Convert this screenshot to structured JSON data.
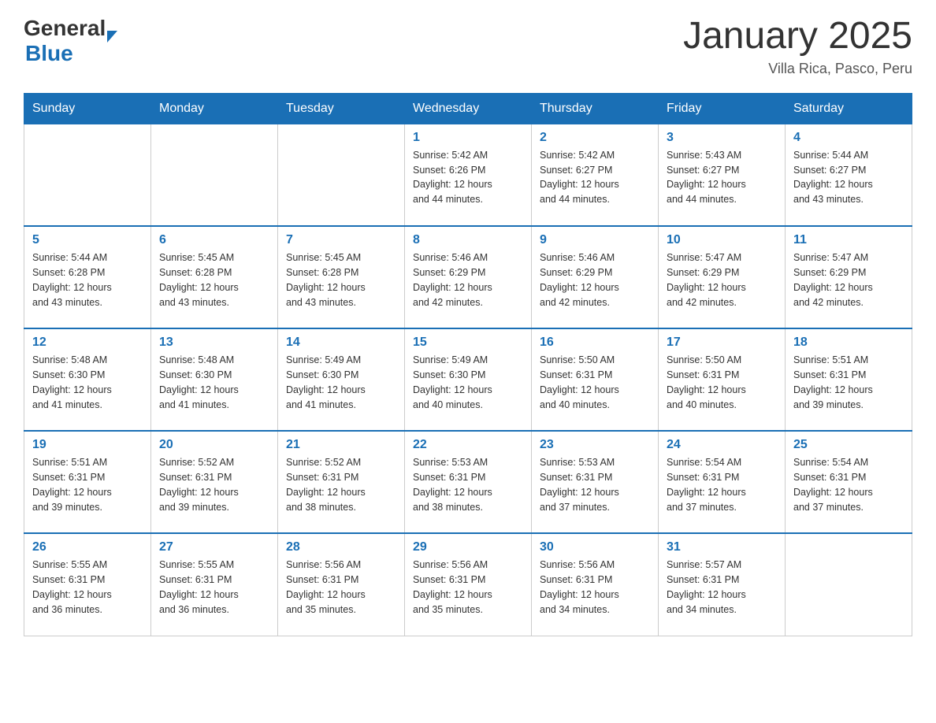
{
  "header": {
    "logo_general": "General",
    "logo_blue": "Blue",
    "title": "January 2025",
    "subtitle": "Villa Rica, Pasco, Peru"
  },
  "days_of_week": [
    "Sunday",
    "Monday",
    "Tuesday",
    "Wednesday",
    "Thursday",
    "Friday",
    "Saturday"
  ],
  "weeks": [
    [
      {
        "day": "",
        "info": ""
      },
      {
        "day": "",
        "info": ""
      },
      {
        "day": "",
        "info": ""
      },
      {
        "day": "1",
        "info": "Sunrise: 5:42 AM\nSunset: 6:26 PM\nDaylight: 12 hours\nand 44 minutes."
      },
      {
        "day": "2",
        "info": "Sunrise: 5:42 AM\nSunset: 6:27 PM\nDaylight: 12 hours\nand 44 minutes."
      },
      {
        "day": "3",
        "info": "Sunrise: 5:43 AM\nSunset: 6:27 PM\nDaylight: 12 hours\nand 44 minutes."
      },
      {
        "day": "4",
        "info": "Sunrise: 5:44 AM\nSunset: 6:27 PM\nDaylight: 12 hours\nand 43 minutes."
      }
    ],
    [
      {
        "day": "5",
        "info": "Sunrise: 5:44 AM\nSunset: 6:28 PM\nDaylight: 12 hours\nand 43 minutes."
      },
      {
        "day": "6",
        "info": "Sunrise: 5:45 AM\nSunset: 6:28 PM\nDaylight: 12 hours\nand 43 minutes."
      },
      {
        "day": "7",
        "info": "Sunrise: 5:45 AM\nSunset: 6:28 PM\nDaylight: 12 hours\nand 43 minutes."
      },
      {
        "day": "8",
        "info": "Sunrise: 5:46 AM\nSunset: 6:29 PM\nDaylight: 12 hours\nand 42 minutes."
      },
      {
        "day": "9",
        "info": "Sunrise: 5:46 AM\nSunset: 6:29 PM\nDaylight: 12 hours\nand 42 minutes."
      },
      {
        "day": "10",
        "info": "Sunrise: 5:47 AM\nSunset: 6:29 PM\nDaylight: 12 hours\nand 42 minutes."
      },
      {
        "day": "11",
        "info": "Sunrise: 5:47 AM\nSunset: 6:29 PM\nDaylight: 12 hours\nand 42 minutes."
      }
    ],
    [
      {
        "day": "12",
        "info": "Sunrise: 5:48 AM\nSunset: 6:30 PM\nDaylight: 12 hours\nand 41 minutes."
      },
      {
        "day": "13",
        "info": "Sunrise: 5:48 AM\nSunset: 6:30 PM\nDaylight: 12 hours\nand 41 minutes."
      },
      {
        "day": "14",
        "info": "Sunrise: 5:49 AM\nSunset: 6:30 PM\nDaylight: 12 hours\nand 41 minutes."
      },
      {
        "day": "15",
        "info": "Sunrise: 5:49 AM\nSunset: 6:30 PM\nDaylight: 12 hours\nand 40 minutes."
      },
      {
        "day": "16",
        "info": "Sunrise: 5:50 AM\nSunset: 6:31 PM\nDaylight: 12 hours\nand 40 minutes."
      },
      {
        "day": "17",
        "info": "Sunrise: 5:50 AM\nSunset: 6:31 PM\nDaylight: 12 hours\nand 40 minutes."
      },
      {
        "day": "18",
        "info": "Sunrise: 5:51 AM\nSunset: 6:31 PM\nDaylight: 12 hours\nand 39 minutes."
      }
    ],
    [
      {
        "day": "19",
        "info": "Sunrise: 5:51 AM\nSunset: 6:31 PM\nDaylight: 12 hours\nand 39 minutes."
      },
      {
        "day": "20",
        "info": "Sunrise: 5:52 AM\nSunset: 6:31 PM\nDaylight: 12 hours\nand 39 minutes."
      },
      {
        "day": "21",
        "info": "Sunrise: 5:52 AM\nSunset: 6:31 PM\nDaylight: 12 hours\nand 38 minutes."
      },
      {
        "day": "22",
        "info": "Sunrise: 5:53 AM\nSunset: 6:31 PM\nDaylight: 12 hours\nand 38 minutes."
      },
      {
        "day": "23",
        "info": "Sunrise: 5:53 AM\nSunset: 6:31 PM\nDaylight: 12 hours\nand 37 minutes."
      },
      {
        "day": "24",
        "info": "Sunrise: 5:54 AM\nSunset: 6:31 PM\nDaylight: 12 hours\nand 37 minutes."
      },
      {
        "day": "25",
        "info": "Sunrise: 5:54 AM\nSunset: 6:31 PM\nDaylight: 12 hours\nand 37 minutes."
      }
    ],
    [
      {
        "day": "26",
        "info": "Sunrise: 5:55 AM\nSunset: 6:31 PM\nDaylight: 12 hours\nand 36 minutes."
      },
      {
        "day": "27",
        "info": "Sunrise: 5:55 AM\nSunset: 6:31 PM\nDaylight: 12 hours\nand 36 minutes."
      },
      {
        "day": "28",
        "info": "Sunrise: 5:56 AM\nSunset: 6:31 PM\nDaylight: 12 hours\nand 35 minutes."
      },
      {
        "day": "29",
        "info": "Sunrise: 5:56 AM\nSunset: 6:31 PM\nDaylight: 12 hours\nand 35 minutes."
      },
      {
        "day": "30",
        "info": "Sunrise: 5:56 AM\nSunset: 6:31 PM\nDaylight: 12 hours\nand 34 minutes."
      },
      {
        "day": "31",
        "info": "Sunrise: 5:57 AM\nSunset: 6:31 PM\nDaylight: 12 hours\nand 34 minutes."
      },
      {
        "day": "",
        "info": ""
      }
    ]
  ]
}
